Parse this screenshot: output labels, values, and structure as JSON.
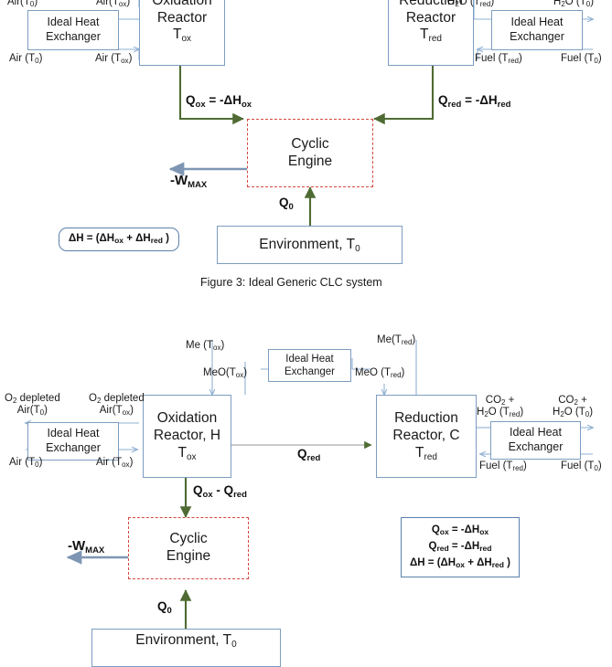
{
  "figure": {
    "caption": "Figure 3: Ideal Generic CLC system"
  },
  "colors": {
    "box_border": "#7d9dc0",
    "engine_border": "#d2483f",
    "heat_arrow": "#4f6b33",
    "stream_arrow": "#8fb0d3",
    "work_arrow": "#7e96b4",
    "eq_border": "#5b80ab",
    "qred_arrow": "#b8b8b8"
  },
  "top_diagram": {
    "oxidation_reactor": {
      "line1": "Oxidation",
      "line2": "Reactor",
      "line3": "T",
      "line3_sub": "ox"
    },
    "reduction_reactor": {
      "line1": "Reduction",
      "line2": "Reactor",
      "line3": "T",
      "line3_sub": "red"
    },
    "engine": {
      "line1": "Cyclic",
      "line2": "Engine"
    },
    "environment": {
      "text": "Environment, T",
      "sub": "0"
    },
    "heat_exchanger_left": {
      "line1": "Ideal Heat",
      "line2": "Exchanger"
    },
    "heat_exchanger_right": {
      "line1": "Ideal Heat",
      "line2": "Exchanger"
    },
    "streams": {
      "air_out_t0": "Air(T",
      "air_out_t0_sub": "0",
      "air_out_tox": "Air(T",
      "air_out_tox_sub": "ox",
      "air_in_t0": "Air (T",
      "air_in_t0_sub": "0",
      "air_in_tox": "Air (T",
      "air_in_tox_sub": "ox",
      "h2o_tred": "H",
      "h2o_tred_sub1": "2",
      "h2o_tred_mid": "O (T",
      "h2o_tred_sub2": "red",
      "h2o_t0": "H",
      "h2o_t0_sub1": "2",
      "h2o_t0_mid": "O (T",
      "h2o_t0_sub2": "0",
      "fuel_tred": "Fuel (T",
      "fuel_tred_sub": "red",
      "fuel_t0": "Fuel (T",
      "fuel_t0_sub": "0"
    },
    "heat_labels": {
      "qox": "Q",
      "qox_sub": "ox",
      "qox_rest": " = -ΔH",
      "qox_sub2": "ox",
      "qred": "Q",
      "qred_sub": "red",
      "qred_rest": " = -ΔH",
      "qred_sub2": "red",
      "q0": "Q",
      "q0_sub": "0",
      "wmax": "-W",
      "wmax_sub": "MAX"
    },
    "equation": {
      "part1": "ΔH  = (ΔH",
      "sub1": "ox",
      "part2": " + ΔH",
      "sub2": "red",
      "part3": " )"
    }
  },
  "bottom_diagram": {
    "oxidation_reactor": {
      "line1": "Oxidation",
      "line2": "Reactor, H",
      "line3": "T",
      "line3_sub": "ox"
    },
    "reduction_reactor": {
      "line1": "Reduction",
      "line2": "Reactor, C",
      "line3": "T",
      "line3_sub": "red"
    },
    "engine": {
      "line1": "Cyclic",
      "line2": "Engine"
    },
    "environment": {
      "text": "Environment, T",
      "sub": "0"
    },
    "heat_exchanger_left": {
      "line1": "Ideal Heat",
      "line2": "Exchanger"
    },
    "heat_exchanger_center": {
      "line1": "Ideal Heat",
      "line2": "Exchanger"
    },
    "heat_exchanger_right": {
      "line1": "Ideal Heat",
      "line2": "Exchanger"
    },
    "streams": {
      "me_tox": "Me (T",
      "me_tox_sub": "ox",
      "meo_tox": "MeO(T",
      "meo_tox_sub": "ox",
      "me_tred": "Me(T",
      "me_tred_sub": "red",
      "meo_tred": "MeO (T",
      "meo_tred_sub": "red",
      "o2_depleted_1a": "O",
      "o2_depleted_1a_sub": "2",
      "o2_depleted_1b": " depleted",
      "o2_depleted_1c": "Air(T",
      "o2_depleted_1c_sub": "0",
      "o2_depleted_2a": "O",
      "o2_depleted_2a_sub": "2",
      "o2_depleted_2b": " depleted",
      "o2_depleted_2c": "Air(T",
      "o2_depleted_2c_sub": "ox",
      "air_in_t0": "Air (T",
      "air_in_t0_sub": "0",
      "air_in_tox": "Air (T",
      "air_in_tox_sub": "ox",
      "co2_1": "CO",
      "co2_1_sub": "2",
      "co2_1_plus": " +",
      "h2o_tred": "H",
      "h2o_tred_sub1": "2",
      "h2o_tred_mid": "O (T",
      "h2o_tred_sub2": "red",
      "co2_2": "CO",
      "co2_2_sub": "2",
      "co2_2_plus": " +",
      "h2o_t0": "H",
      "h2o_t0_sub1": "2",
      "h2o_t0_mid": "O (T",
      "h2o_t0_sub2": "0",
      "fuel_tred": "Fuel (T",
      "fuel_tred_sub": "red",
      "fuel_t0": "Fuel (T",
      "fuel_t0_sub": "0"
    },
    "heat_labels": {
      "qred": "Q",
      "qred_sub": "red",
      "qox_minus_qred_a": "Q",
      "qox_minus_qred_a_sub": "ox",
      "qox_minus_qred_b": " - Q",
      "qox_minus_qred_b_sub": "red",
      "q0": "Q",
      "q0_sub": "0",
      "wmax": "-W",
      "wmax_sub": "MAX"
    },
    "equation": {
      "l1_a": "Q",
      "l1_a_sub": "ox",
      "l1_b": " = -ΔH",
      "l1_b_sub": "ox",
      "l2_a": "Q",
      "l2_a_sub": "red",
      "l2_b": " = -ΔH",
      "l2_b_sub": "red",
      "l3_a": "ΔH  = (ΔH",
      "l3_a_sub": "ox",
      "l3_b": " + ΔH",
      "l3_b_sub": "red",
      "l3_c": " )"
    }
  }
}
